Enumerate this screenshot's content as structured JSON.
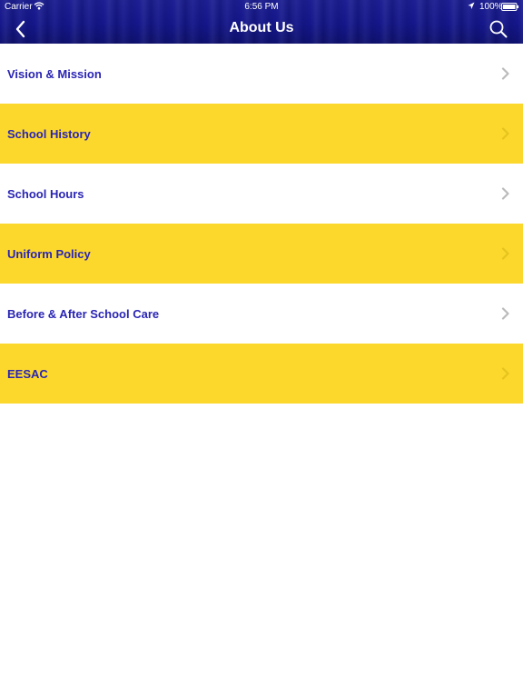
{
  "status_bar": {
    "carrier": "Carrier",
    "time": "6:56 PM",
    "battery": "100%"
  },
  "nav": {
    "title": "About Us",
    "back_icon": "chevron-left-icon",
    "search_icon": "search-icon"
  },
  "colors": {
    "nav_bg": "#14168a",
    "row_yellow": "#fdd82c",
    "row_white": "#ffffff",
    "label_color": "#2a25b4",
    "chevron": "#bbbbbb"
  },
  "menu": {
    "items": [
      {
        "label": "Vision & Mission",
        "style": "white"
      },
      {
        "label": "School History",
        "style": "yellow"
      },
      {
        "label": "School Hours",
        "style": "white"
      },
      {
        "label": "Uniform Policy",
        "style": "yellow"
      },
      {
        "label": "Before & After School Care",
        "style": "white"
      },
      {
        "label": "EESAC",
        "style": "yellow"
      }
    ]
  }
}
